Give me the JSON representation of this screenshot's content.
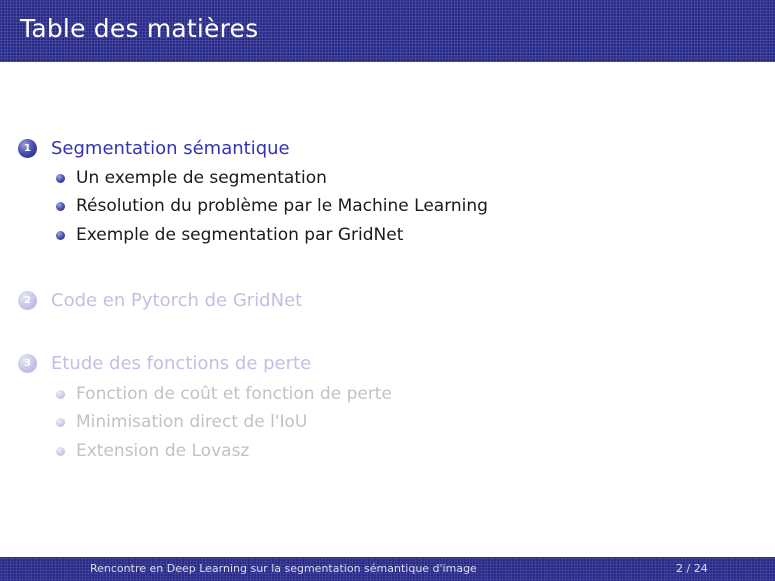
{
  "header": {
    "title": "Table des matières"
  },
  "sections": [
    {
      "number": "1",
      "title": "Segmentation sémantique",
      "state": "active",
      "subsections": [
        {
          "title": "Un exemple de segmentation"
        },
        {
          "title": "Résolution du problème par le Machine Learning"
        },
        {
          "title": "Exemple de segmentation par GridNet"
        }
      ]
    },
    {
      "number": "2",
      "title": "Code en Pytorch de GridNet",
      "state": "faded",
      "subsections": []
    },
    {
      "number": "3",
      "title": "Etude des fonctions de perte",
      "state": "faded",
      "subsections": [
        {
          "title": "Fonction de coût et fonction de perte"
        },
        {
          "title": "Minimisation direct de l'IoU"
        },
        {
          "title": "Extension de Lovasz"
        }
      ]
    }
  ],
  "footer": {
    "talk_title": "Rencontre en Deep Learning sur la segmentation sémantique d'image",
    "page": "2 / 24"
  },
  "colors": {
    "banner": "#2a2d8c",
    "active_section": "#3333b2",
    "faded_section": "#bfc0e4",
    "faded_text": "#c2c2c2"
  }
}
